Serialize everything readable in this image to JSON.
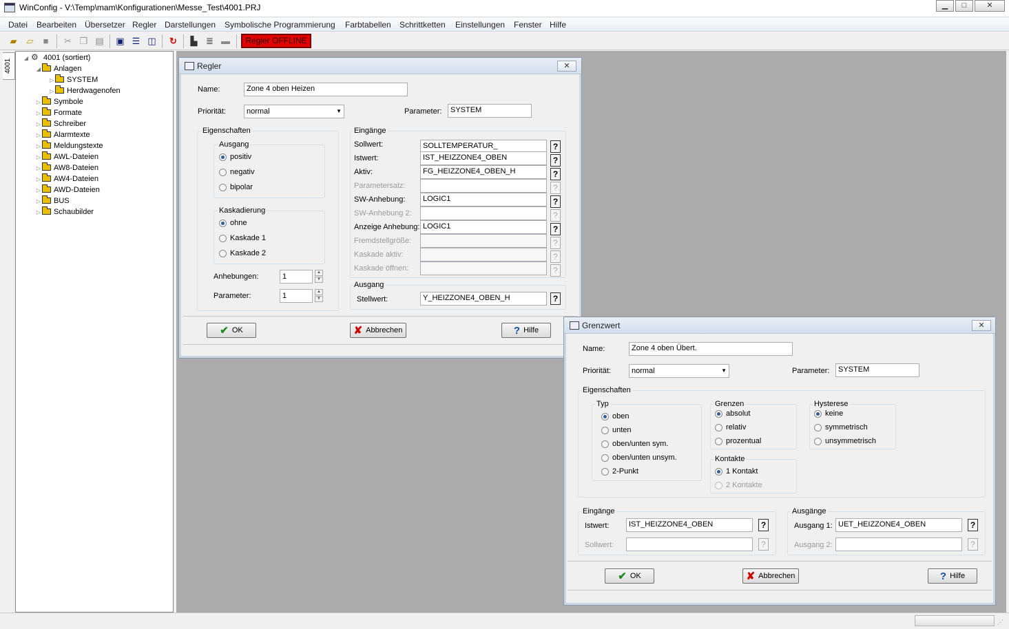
{
  "window": {
    "title": "WinConfig - V:\\Temp\\mam\\Konfigurationen\\Messe_Test\\4001.PRJ",
    "min": "▁",
    "max": "□",
    "close": "✕"
  },
  "menu": [
    "Datei",
    "Bearbeiten",
    "Übersetzer",
    "Regler",
    "Darstellungen",
    "Symbolische Programmierung",
    "Farbtabellen",
    "Schrittketten",
    "Einstellungen",
    "Fenster",
    "Hilfe"
  ],
  "toolbar": {
    "status": "Regler OFFLINE",
    "icons": [
      "new-project-icon",
      "open-folder-icon",
      "save-icon",
      "cut-icon",
      "copy-icon",
      "paste-icon",
      "cascade-windows-icon",
      "tile-horizontal-icon",
      "tile-vertical-icon",
      "refresh-icon",
      "compile-icon",
      "list-icon",
      "monitor-icon"
    ]
  },
  "sidetab": "4001",
  "tree": {
    "root": "4001 (sortiert)",
    "anlagen": "Anlagen",
    "children": [
      "SYSTEM",
      "Herdwagenofen"
    ],
    "items": [
      "Symbole",
      "Formate",
      "Schreiber",
      "Alarmtexte",
      "Meldungstexte",
      "AWL-Dateien",
      "AW8-Dateien",
      "AW4-Dateien",
      "AWD-Dateien",
      "BUS",
      "Schaubilder"
    ]
  },
  "regler": {
    "title": "Regler",
    "name_label": "Name:",
    "name": "Zone 4 oben Heizen",
    "prio_label": "Priorität:",
    "prio": "normal",
    "param_label": "Parameter:",
    "param": "SYSTEM",
    "props_label": "Eigenschaften",
    "ausgang_label": "Ausgang",
    "ausgang_opts": [
      "positiv",
      "negativ",
      "bipolar"
    ],
    "kaskade_label": "Kaskadierung",
    "kaskade_opts": [
      "ohne",
      "Kaskade 1",
      "Kaskade 2"
    ],
    "anheb_label": "Anhebungen:",
    "anheb": "1",
    "params_label": "Parameter:",
    "params": "1",
    "eing_label": "Eingänge",
    "inputs": [
      {
        "label": "Sollwert:",
        "value": "SOLLTEMPERATUR_"
      },
      {
        "label": "Istwert:",
        "value": "IST_HEIZZONE4_OBEN"
      },
      {
        "label": "Aktiv:",
        "value": "FG_HEIZZONE4_OBEN_H"
      },
      {
        "label": "Parametersatz:",
        "value": ""
      },
      {
        "label": "SW-Anhebung:",
        "value": "LOGIC1"
      },
      {
        "label": "SW-Anhebung 2:",
        "value": ""
      },
      {
        "label": "Anzeige Anhebung:",
        "value": "LOGIC1"
      },
      {
        "label": "Fremdstellgröße:",
        "value": ""
      },
      {
        "label": "Kaskade aktiv:",
        "value": ""
      },
      {
        "label": "Kaskade öffnen:",
        "value": ""
      }
    ],
    "out_label": "Ausgang",
    "stell_label": "Stellwert:",
    "stell": "Y_HEIZZONE4_OBEN_H",
    "ok": "OK",
    "cancel": "Abbrechen",
    "help": "Hilfe",
    "q": "?"
  },
  "grenz": {
    "title": "Grenzwert",
    "name_label": "Name:",
    "name": "Zone 4 oben Übert.",
    "prio_label": "Priorität:",
    "prio": "normal",
    "param_label": "Parameter:",
    "param": "SYSTEM",
    "props_label": "Eigenschaften",
    "typ_label": "Typ",
    "typ_opts": [
      "oben",
      "unten",
      "oben/unten sym.",
      "oben/unten unsym.",
      "2-Punkt"
    ],
    "grenzen_label": "Grenzen",
    "grenzen_opts": [
      "absolut",
      "relativ",
      "prozentual"
    ],
    "hyst_label": "Hysterese",
    "hyst_opts": [
      "keine",
      "symmetrisch",
      "unsymmetrisch"
    ],
    "kont_label": "Kontakte",
    "kont_opts": [
      "1 Kontakt",
      "2 Kontakte"
    ],
    "eing_label": "Eingänge",
    "ist_label": "Istwert:",
    "ist": "IST_HEIZZONE4_OBEN",
    "soll_label": "Sollwert:",
    "soll": "",
    "ausg_label": "Ausgänge",
    "a1_label": "Ausgang 1:",
    "a1": "UET_HEIZZONE4_OBEN",
    "a2_label": "Ausgang 2:",
    "a2": "",
    "ok": "OK",
    "cancel": "Abbrechen",
    "help": "Hilfe",
    "q": "?"
  }
}
